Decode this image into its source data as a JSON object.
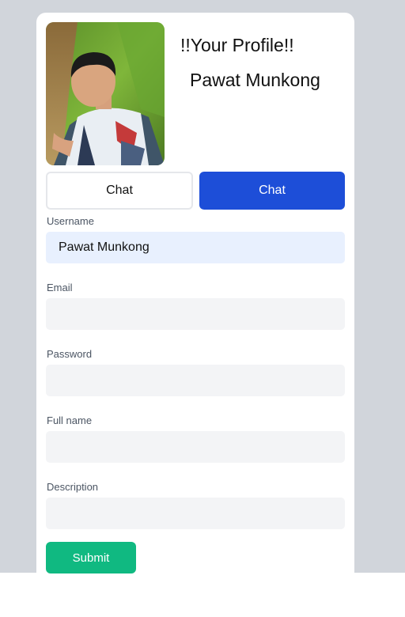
{
  "profile": {
    "heading": "!!Your Profile!!",
    "name": "Pawat Munkong",
    "avatar_icon": "user-photo"
  },
  "actions": {
    "chat_outline_label": "Chat",
    "chat_primary_label": "Chat"
  },
  "form": {
    "fields": [
      {
        "label": "Username",
        "value": "Pawat Munkong",
        "placeholder": ""
      },
      {
        "label": "Email",
        "value": "",
        "placeholder": ""
      },
      {
        "label": "Password",
        "value": "",
        "placeholder": ""
      },
      {
        "label": "Full name",
        "value": "",
        "placeholder": ""
      },
      {
        "label": "Description",
        "value": "",
        "placeholder": ""
      }
    ],
    "submit_label": "Submit"
  },
  "colors": {
    "backdrop": "#d1d5db",
    "primary": "#1d4ed8",
    "submit": "#10b981",
    "autofill": "#e8f0fe",
    "input_bg": "#f3f4f6"
  }
}
